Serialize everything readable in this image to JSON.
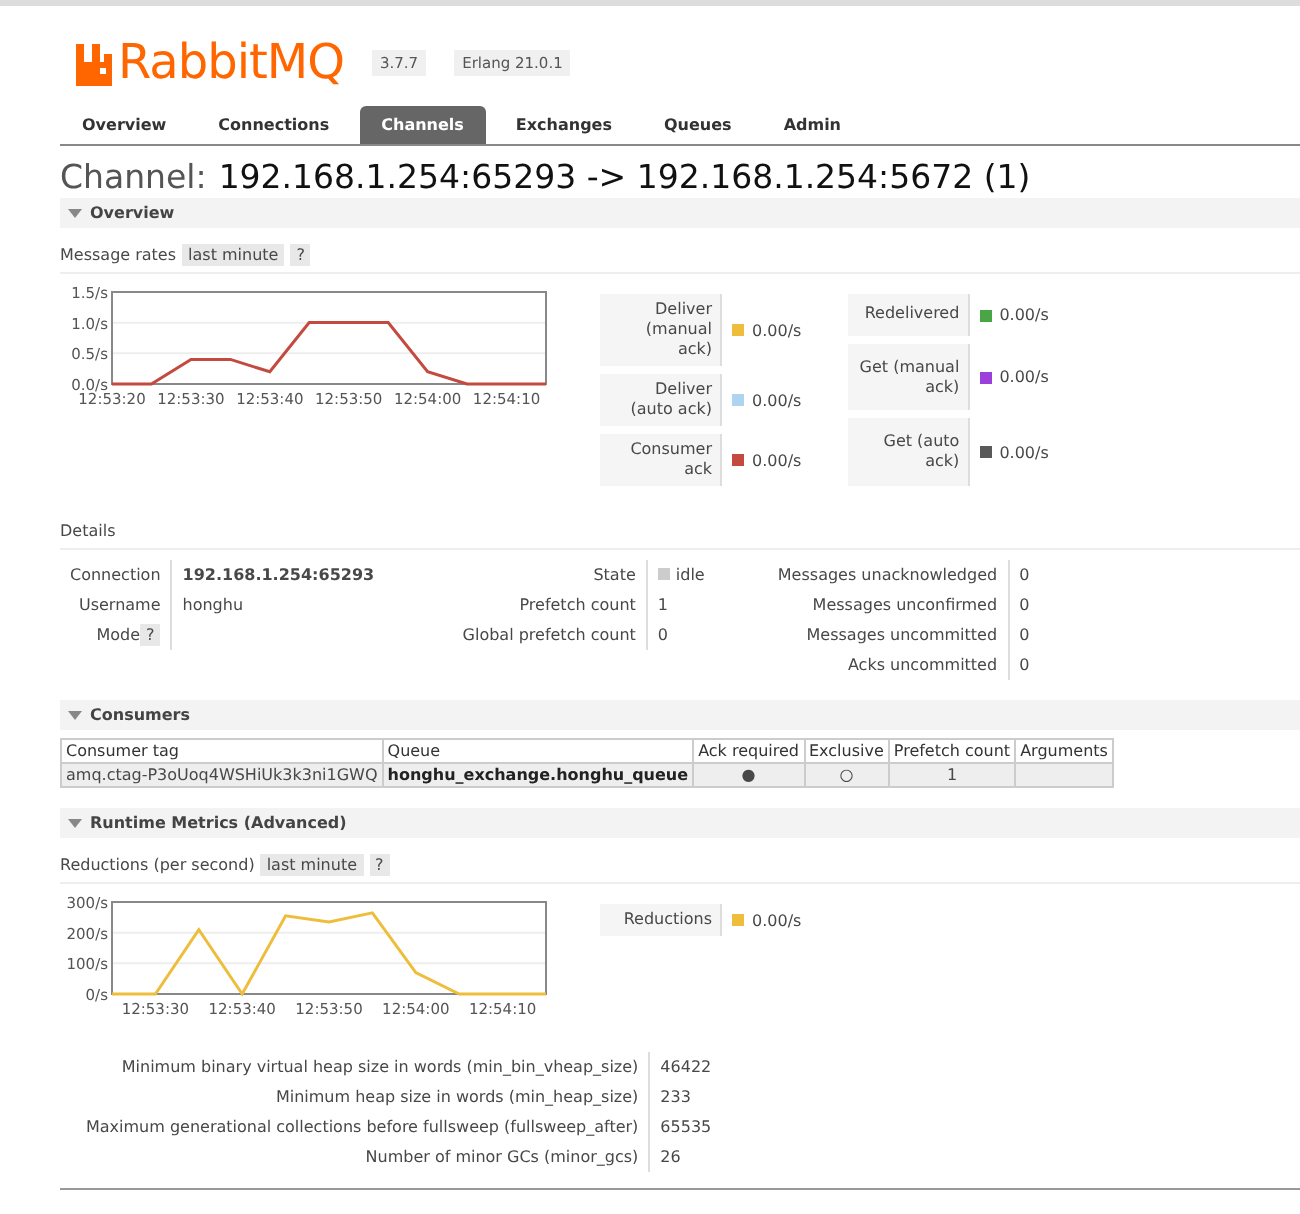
{
  "header": {
    "logo": "RabbitMQ",
    "version": "3.7.7",
    "erlang": "Erlang 21.0.1"
  },
  "tabs": [
    {
      "label": "Overview",
      "selected": false
    },
    {
      "label": "Connections",
      "selected": false
    },
    {
      "label": "Channels",
      "selected": true
    },
    {
      "label": "Exchanges",
      "selected": false
    },
    {
      "label": "Queues",
      "selected": false
    },
    {
      "label": "Admin",
      "selected": false
    }
  ],
  "page_title": {
    "prefix": "Channel:",
    "name": "192.168.1.254:65293 -> 192.168.1.254:5672 (1)"
  },
  "overview": {
    "title": "Overview",
    "expanded": true,
    "rates_label": "Message rates",
    "range": "last minute",
    "help": "?",
    "chart_data": {
      "type": "line",
      "categories": [
        "12:53:20",
        null,
        "12:53:30",
        null,
        "12:53:40",
        null,
        "12:53:50",
        null,
        "12:54:00",
        null,
        "12:54:10",
        null
      ],
      "ylim": [
        0,
        1.5
      ],
      "yticks": [
        {
          "value": 0,
          "label": "0.0/s"
        },
        {
          "value": 0.5,
          "label": "0.5/s"
        },
        {
          "value": 1,
          "label": "1.0/s"
        },
        {
          "value": 1.5,
          "label": "1.5/s"
        }
      ],
      "series": [
        {
          "color": "#c4493f",
          "values": [
            0,
            0,
            0.4,
            0.4,
            0.2,
            1,
            1,
            1,
            0.2,
            0,
            0,
            0
          ]
        }
      ]
    },
    "legend": [
      [
        {
          "label": "Deliver (manual ack)",
          "color": "#edbd3b",
          "value": "0.00/s"
        },
        {
          "label": "Deliver (auto ack)",
          "color": "#aed4ef",
          "value": "0.00/s"
        },
        {
          "label": "Consumer ack",
          "color": "#c4493f",
          "value": "0.00/s"
        }
      ],
      [
        {
          "label": "Redelivered",
          "color": "#4aa546",
          "value": "0.00/s"
        },
        {
          "label": "Get (manual ack)",
          "color": "#9b3fdc",
          "value": "0.00/s"
        },
        {
          "label": "Get (auto ack)",
          "color": "#595959",
          "value": "0.00/s"
        }
      ]
    ]
  },
  "details": {
    "title": "Details",
    "columns": [
      [
        {
          "label": "Connection",
          "value": "192.168.1.254:65293",
          "kind": "bold"
        },
        {
          "label": "Username",
          "value": "honghu",
          "kind": "plain"
        },
        {
          "label": "Mode",
          "help": "?",
          "kind": "help"
        }
      ],
      [
        {
          "label": "State",
          "value": "idle",
          "kind": "status"
        },
        {
          "label": "Prefetch count",
          "value": "1",
          "kind": "plain"
        },
        {
          "label": "Global prefetch count",
          "value": "0",
          "kind": "plain"
        }
      ],
      [
        {
          "label": "Messages unacknowledged",
          "value": "0",
          "kind": "plain"
        },
        {
          "label": "Messages unconfirmed",
          "value": "0",
          "kind": "plain"
        },
        {
          "label": "Messages uncommitted",
          "value": "0",
          "kind": "plain"
        },
        {
          "label": "Acks uncommitted",
          "value": "0",
          "kind": "plain"
        }
      ]
    ]
  },
  "consumers": {
    "title": "Consumers",
    "expanded": true,
    "columns": [
      {
        "label": "Consumer tag",
        "kind": "text"
      },
      {
        "label": "Queue",
        "kind": "link"
      },
      {
        "label": "Ack required",
        "kind": "mark"
      },
      {
        "label": "Exclusive",
        "kind": "mark"
      },
      {
        "label": "Prefetch count",
        "kind": "mark"
      },
      {
        "label": "Arguments",
        "kind": "text"
      }
    ],
    "rows": [
      {
        "cells": [
          "amq.ctag-P3oUoq4WSHiUk3k3ni1GWQ",
          "honghu_exchange.honghu_queue",
          "●",
          "○",
          "1"
        ]
      }
    ]
  },
  "runtime": {
    "title": "Runtime Metrics (Advanced)",
    "expanded": true,
    "rates_label": "Reductions (per second)",
    "range": "last minute",
    "help": "?",
    "chart_data": {
      "type": "line",
      "categories": [
        null,
        "12:53:30",
        null,
        "12:53:40",
        null,
        "12:53:50",
        null,
        "12:54:00",
        null,
        "12:54:10",
        null
      ],
      "ylim": [
        0,
        300
      ],
      "yticks": [
        {
          "value": 0,
          "label": "0/s"
        },
        {
          "value": 100,
          "label": "100/s"
        },
        {
          "value": 200,
          "label": "200/s"
        },
        {
          "value": 300,
          "label": "300/s"
        }
      ],
      "series": [
        {
          "color": "#edbd3b",
          "values": [
            0,
            0,
            210,
            0,
            255,
            235,
            265,
            70,
            0,
            0,
            0
          ]
        }
      ]
    },
    "legend": [
      [
        {
          "label": "Reductions",
          "color": "#edbd3b",
          "value": "0.00/s"
        }
      ]
    ],
    "metrics": [
      {
        "label": "Minimum binary virtual heap size in words (min_bin_vheap_size)",
        "value": "46422"
      },
      {
        "label": "Minimum heap size in words (min_heap_size)",
        "value": "233"
      },
      {
        "label": "Maximum generational collections before fullsweep (fullsweep_after)",
        "value": "65535"
      },
      {
        "label": "Number of minor GCs (minor_gcs)",
        "value": "26"
      }
    ]
  }
}
